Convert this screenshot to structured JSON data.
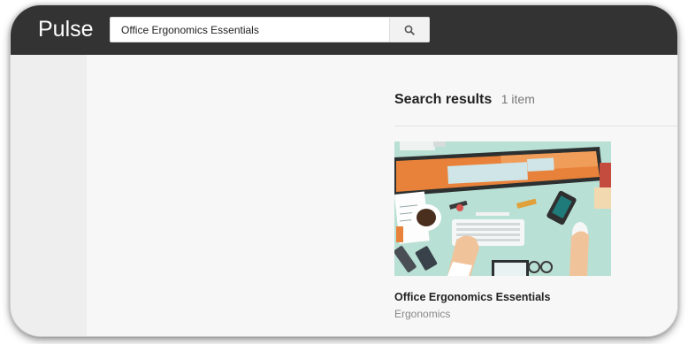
{
  "app": {
    "name": "Pulse"
  },
  "search": {
    "value": "Office Ergonomics Essentials",
    "button_icon": "search-icon"
  },
  "results": {
    "title": "Search results",
    "count_label": "1 item",
    "items": [
      {
        "title": "Office Ergonomics Essentials",
        "category": "Ergonomics",
        "thumbnail": "desk-illustration"
      }
    ]
  },
  "colors": {
    "topbar": "#333333",
    "background": "#f7f7f7",
    "sidebar": "#eeeeee",
    "accent_orange": "#e8823a",
    "desk": "#b9e0d4"
  }
}
